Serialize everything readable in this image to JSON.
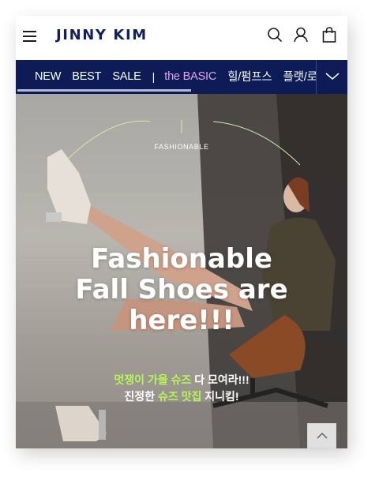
{
  "header": {
    "logo": "JINNY KIM",
    "icons": [
      "menu-icon",
      "search-icon",
      "user-icon",
      "shopping-bag-icon"
    ]
  },
  "nav": {
    "items": [
      {
        "label": "NEW"
      },
      {
        "label": "BEST"
      },
      {
        "label": "SALE"
      },
      {
        "label": "the BASIC"
      },
      {
        "label": "힐/펌프스"
      },
      {
        "label": "플랫/로"
      }
    ],
    "separator": "|",
    "accent_color": "#e8a4e6",
    "background": "#0d1b57"
  },
  "hero": {
    "tag": "FASHIONABLE",
    "title_lines": [
      "Fashionable",
      "Fall Shoes are",
      "here!!!"
    ],
    "sub1": {
      "highlight": "멋쟁이 가을 슈즈",
      "rest": " 다 모여라!!!"
    },
    "sub2": {
      "pre": "진정한 ",
      "highlight": "슈즈 맛집",
      "rest": " 지니킴!"
    },
    "highlight_color": "#b7f55a"
  },
  "scroll_top": {
    "icon": "chevron-up-icon"
  }
}
